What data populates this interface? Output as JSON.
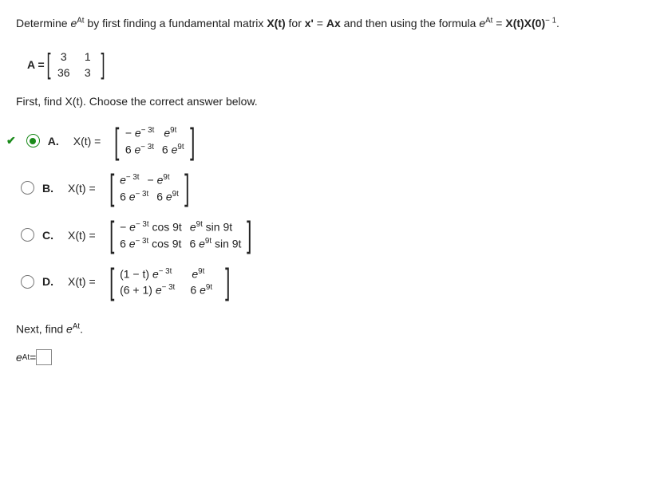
{
  "question": {
    "prefix": "Determine ",
    "e": "e",
    "At": "At",
    "mid1": " by first finding a fundamental matrix ",
    "Xt": "X(t)",
    "mid2": " for ",
    "eqn_lhs": "x'",
    "eqn_eq": " = ",
    "eqn_rhs": "Ax",
    "mid3": " and then using the formula ",
    "formula_rhs_eq": " = ",
    "formula_X0inv": "X(t)X(0)",
    "formula_exp": "− 1",
    "period": "."
  },
  "matrixA": {
    "label": "A = ",
    "rows": [
      [
        "3",
        "1"
      ],
      [
        "36",
        "3"
      ]
    ]
  },
  "prompt1": "First, find X(t). Choose the correct answer below.",
  "choices": [
    {
      "key": "A",
      "label": "A.",
      "selected": true,
      "correct": true,
      "lhs": "X(t) = ",
      "rows": [
        [
          {
            "pre": "− ",
            "base": "e",
            "sup": "− 3t"
          },
          {
            "pre": "",
            "base": "e",
            "sup": "9t"
          }
        ],
        [
          {
            "pre": "6 ",
            "base": "e",
            "sup": "− 3t"
          },
          {
            "pre": "6 ",
            "base": "e",
            "sup": "9t"
          }
        ]
      ]
    },
    {
      "key": "B",
      "label": "B.",
      "selected": false,
      "lhs": "X(t) = ",
      "rows": [
        [
          {
            "pre": "",
            "base": "e",
            "sup": "− 3t"
          },
          {
            "pre": "− ",
            "base": "e",
            "sup": "9t"
          }
        ],
        [
          {
            "pre": "6 ",
            "base": "e",
            "sup": "− 3t"
          },
          {
            "pre": "6 ",
            "base": "e",
            "sup": "9t"
          }
        ]
      ]
    },
    {
      "key": "C",
      "label": "C.",
      "selected": false,
      "lhs": "X(t) = ",
      "rows": [
        [
          {
            "pre": "− ",
            "base": "e",
            "sup": "− 3t",
            "post": " cos 9t"
          },
          {
            "pre": "",
            "base": "e",
            "sup": "9t",
            "post": " sin 9t"
          }
        ],
        [
          {
            "pre": "6 ",
            "base": "e",
            "sup": "− 3t",
            "post": " cos 9t"
          },
          {
            "pre": "6 ",
            "base": "e",
            "sup": "9t",
            "post": " sin 9t"
          }
        ]
      ]
    },
    {
      "key": "D",
      "label": "D.",
      "selected": false,
      "lhs": "X(t) = ",
      "rows": [
        [
          {
            "pre": "(1 − t) ",
            "base": "e",
            "sup": "− 3t"
          },
          {
            "pre": "",
            "base": "e",
            "sup": "9t"
          }
        ],
        [
          {
            "pre": "(6 + 1) ",
            "base": "e",
            "sup": "− 3t"
          },
          {
            "pre": "6 ",
            "base": "e",
            "sup": "9t"
          }
        ]
      ]
    }
  ],
  "prompt2_prefix": "Next, find ",
  "prompt2_period": ".",
  "answer_eq": " = "
}
